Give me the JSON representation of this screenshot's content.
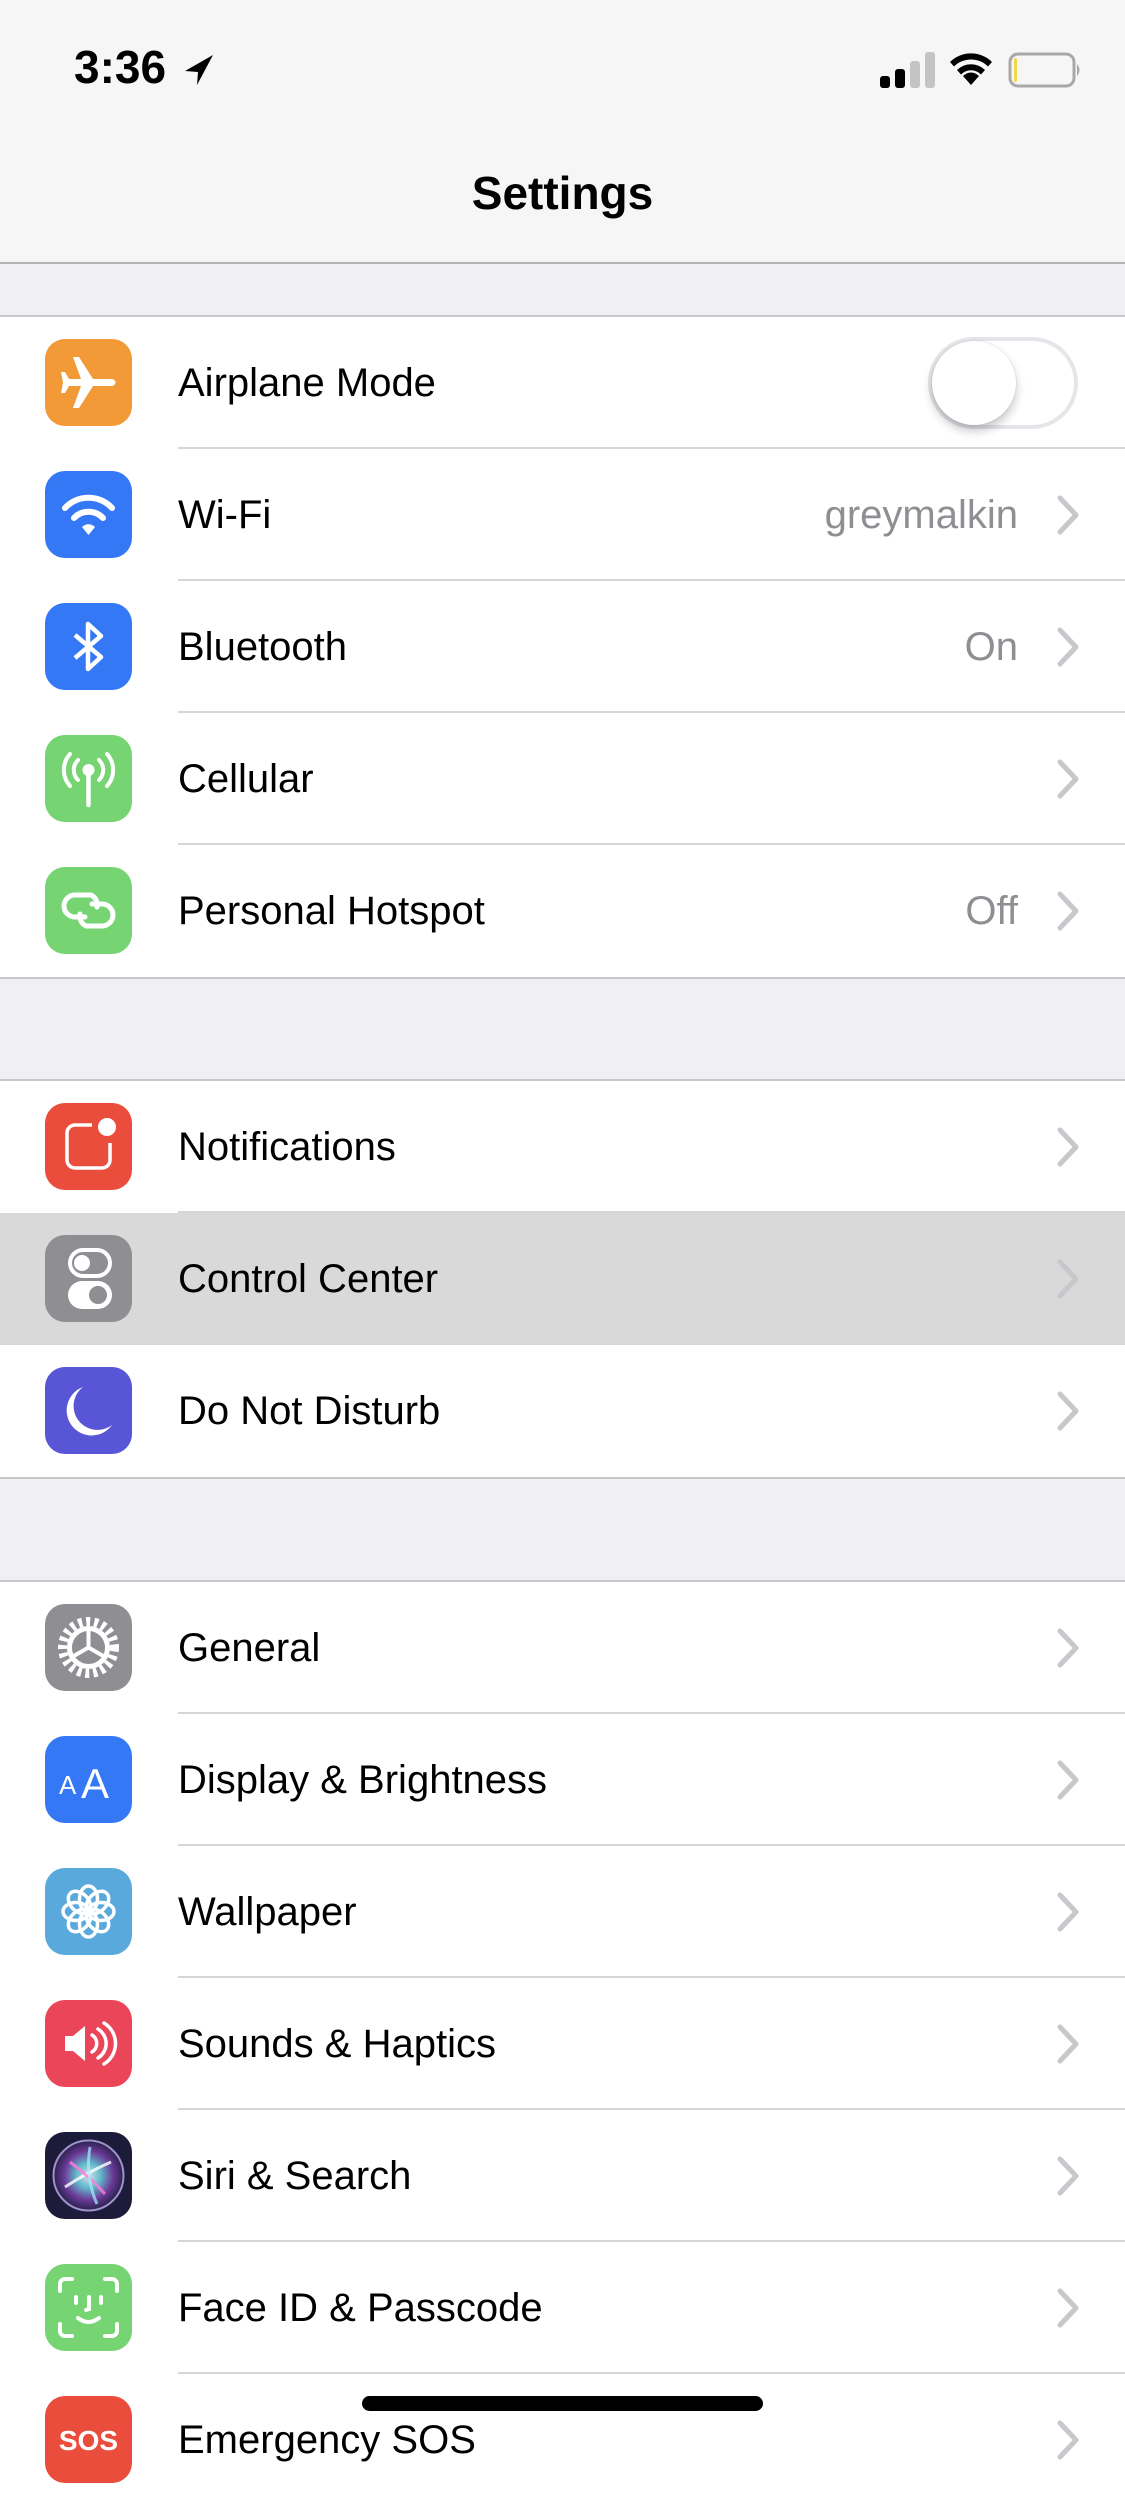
{
  "status_bar": {
    "time": "3:36",
    "location_icon": "location-arrow-icon",
    "signal_bars": 2,
    "signal_bars_total": 4,
    "wifi_icon": "wifi-icon",
    "battery_level": 0.05,
    "battery_color": "#f2d74a"
  },
  "nav": {
    "title": "Settings"
  },
  "groups": [
    {
      "rows": [
        {
          "label": "Airplane Mode",
          "icon": "airplane-icon",
          "icon_color": "#f19a37",
          "control": "toggle",
          "toggle_on": false
        },
        {
          "label": "Wi-Fi",
          "icon": "wifi-icon",
          "icon_color": "#3478f6",
          "value": "greymalkin"
        },
        {
          "label": "Bluetooth",
          "icon": "bluetooth-icon",
          "icon_color": "#3478f6",
          "value": "On"
        },
        {
          "label": "Cellular",
          "icon": "cellular-antenna-icon",
          "icon_color": "#76d472"
        },
        {
          "label": "Personal Hotspot",
          "icon": "hotspot-link-icon",
          "icon_color": "#76d472",
          "value": "Off"
        }
      ]
    },
    {
      "rows": [
        {
          "label": "Notifications",
          "icon": "notifications-icon",
          "icon_color": "#eb4d3d"
        },
        {
          "label": "Control Center",
          "icon": "control-center-icon",
          "icon_color": "#8e8e93",
          "highlighted": true
        },
        {
          "label": "Do Not Disturb",
          "icon": "moon-icon",
          "icon_color": "#5856d6"
        }
      ]
    },
    {
      "rows": [
        {
          "label": "General",
          "icon": "gear-icon",
          "icon_color": "#8e8e93"
        },
        {
          "label": "Display & Brightness",
          "icon": "text-size-icon",
          "icon_color": "#3478f6"
        },
        {
          "label": "Wallpaper",
          "icon": "wallpaper-flower-icon",
          "icon_color": "#5aa9dc"
        },
        {
          "label": "Sounds & Haptics",
          "icon": "speaker-icon",
          "icon_color": "#eb4559"
        },
        {
          "label": "Siri & Search",
          "icon": "siri-icon",
          "icon_color": "#1c1c3a"
        },
        {
          "label": "Face ID & Passcode",
          "icon": "face-id-icon",
          "icon_color": "#76d472"
        },
        {
          "label": "Emergency SOS",
          "icon": "sos-icon",
          "icon_color": "#eb4d3d"
        }
      ]
    }
  ],
  "colors": {
    "background": "#efeff4",
    "separator": "#c8c7cc",
    "value_text": "#8e8e93",
    "chevron": "#c7c7cc",
    "highlight": "#d9d9d9"
  }
}
